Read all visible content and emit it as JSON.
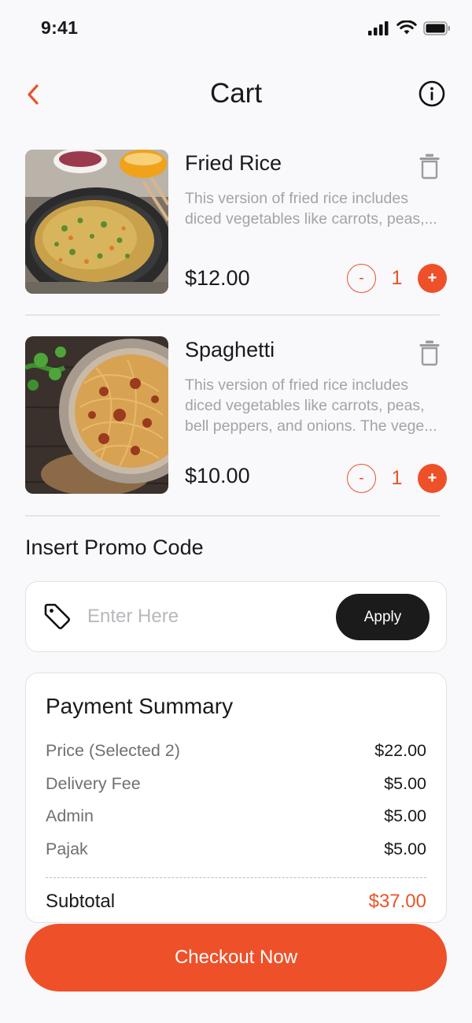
{
  "status_bar": {
    "time": "9:41"
  },
  "header": {
    "title": "Cart"
  },
  "items": [
    {
      "name": "Fried Rice",
      "description_lines": [
        "This version of fried rice includes",
        "diced vegetables like carrots, peas,..."
      ],
      "price": "$12.00",
      "qty_minus": "-",
      "quantity": "1",
      "qty_plus": "+"
    },
    {
      "name": "Spaghetti",
      "description_lines": [
        "This version of fried rice includes",
        "diced vegetables like carrots, peas,",
        "bell peppers, and onions. The vege..."
      ],
      "price": "$10.00",
      "qty_minus": "-",
      "quantity": "1",
      "qty_plus": "+"
    }
  ],
  "promo": {
    "title": "Insert Promo Code",
    "placeholder": "Enter Here",
    "apply_label": "Apply"
  },
  "summary": {
    "title": "Payment Summary",
    "rows": [
      {
        "label": "Price (Selected 2)",
        "value": "$22.00"
      },
      {
        "label": "Delivery Fee",
        "value": "$5.00"
      },
      {
        "label": "Admin",
        "value": "$5.00"
      },
      {
        "label": "Pajak",
        "value": "$5.00"
      }
    ],
    "subtotal_label": "Subtotal",
    "subtotal_value": "$37.00"
  },
  "checkout_label": "Checkout Now",
  "colors": {
    "accent": "#EE5129",
    "dark_button": "#1B1B1B",
    "background": "#F9F9FC"
  },
  "icons": [
    "back-chevron-icon",
    "info-icon",
    "trash-icon",
    "tag-icon",
    "signal-icon",
    "wifi-icon",
    "battery-icon"
  ]
}
